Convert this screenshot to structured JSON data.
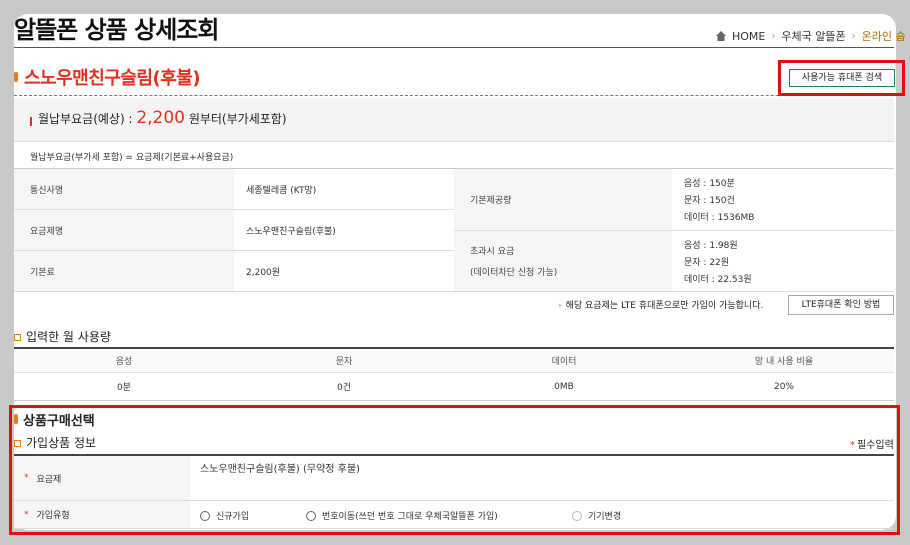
{
  "header": {
    "title": "알뜰폰 상품 상세조회",
    "breadcrumb": [
      "HOME",
      "우체국 알뜰폰",
      "온라인 숍"
    ]
  },
  "product": {
    "name": "스노우맨친구슬림(후불)",
    "search_button": "사용가능 휴대폰 검색"
  },
  "fee": {
    "label": "월납부요금(예상) : ",
    "amount": "2,200",
    "suffix": " 원부터(부가세포함)",
    "formula": "월납부요금(부가세 포함) = 요금제(기본료+사용요금)"
  },
  "info": {
    "carrier_label": "통신사명",
    "carrier_value": "세종텔레콤 (KT망)",
    "plan_label": "요금제명",
    "plan_value": "스노우맨친구슬림(후불)",
    "base_fee_label": "기본료",
    "base_fee_value": "2,200원",
    "provided_label": "기본제공량",
    "provided": [
      "음성 : 150분",
      "문자 : 150건",
      "데이터 : 1536MB"
    ],
    "overage_label_1": "초과시 요금",
    "overage_label_2": "(데이터차단 신청 가능)",
    "overage": [
      "음성 : 1.98원",
      "문자 : 22원",
      "데이터 : 22.53원"
    ]
  },
  "notice": {
    "text": "해당 요금제는 LTE 휴대폰으로만 가입이 가능합니다.",
    "lte_button": "LTE휴대폰 확인 방법"
  },
  "usage": {
    "section_title": "입력한 월 사용량",
    "headers": [
      "음성",
      "문자",
      "데이터",
      "망 내 사용 비율"
    ],
    "values": [
      "0분",
      "0건",
      "0MB",
      "20%"
    ]
  },
  "purchase": {
    "title": "상품구매선택",
    "subsection": "가입상품 정보",
    "required_note": "필수입력",
    "plan_label": "요금제",
    "plan_value": "스노우맨친구슬림(후불) (무약정 후불)",
    "join_type_label": "가입유형",
    "join_options": [
      "신규가입",
      "번호이동(쓰던 번호 그대로 우체국알뜰폰 가입)",
      "기기변경"
    ]
  },
  "colors": {
    "accent_red": "#e0301e",
    "accent_orange": "#ea7b1c",
    "highlight_outline": "#e0100e"
  }
}
